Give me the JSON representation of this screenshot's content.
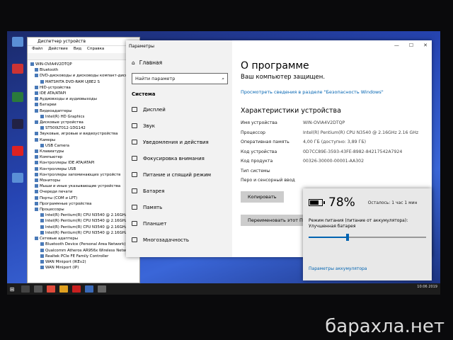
{
  "device_manager": {
    "title": "Диспетчер устройств",
    "menu": [
      "Файл",
      "Действие",
      "Вид",
      "Справка"
    ],
    "tree": [
      {
        "label": "WIN-OVIA4V2DTQP",
        "level": 0
      },
      {
        "label": "Bluetooth",
        "level": 1
      },
      {
        "label": "DVD-дисководы и дисководы компакт-дисков",
        "level": 1
      },
      {
        "label": "MATSHITA DVD-RAM UJ8E2 S",
        "level": 2
      },
      {
        "label": "HID-устройства",
        "level": 1
      },
      {
        "label": "IDE ATA/ATAPI",
        "level": 1
      },
      {
        "label": "Аудиовходы и аудиовыходы",
        "level": 1
      },
      {
        "label": "Батареи",
        "level": 1
      },
      {
        "label": "Видеоадаптеры",
        "level": 1
      },
      {
        "label": "Intel(R) HD Graphics",
        "level": 2
      },
      {
        "label": "Дисковые устройства",
        "level": 1
      },
      {
        "label": "ST500LT012-1DG142",
        "level": 2
      },
      {
        "label": "Звуковые, игровые и видеоустройства",
        "level": 1
      },
      {
        "label": "Камеры",
        "level": 1
      },
      {
        "label": "USB Camera",
        "level": 2
      },
      {
        "label": "Клавиатуры",
        "level": 1
      },
      {
        "label": "Компьютер",
        "level": 1
      },
      {
        "label": "Контроллеры IDE ATA/ATAPI",
        "level": 1
      },
      {
        "label": "Контроллеры USB",
        "level": 1
      },
      {
        "label": "Контроллеры запоминающих устройств",
        "level": 1
      },
      {
        "label": "Мониторы",
        "level": 1
      },
      {
        "label": "Мыши и иные указывающие устройства",
        "level": 1
      },
      {
        "label": "Очереди печати",
        "level": 1
      },
      {
        "label": "Порты (COM и LPT)",
        "level": 1
      },
      {
        "label": "Программные устройства",
        "level": 1
      },
      {
        "label": "Процессоры",
        "level": 1
      },
      {
        "label": "Intel(R) Pentium(R) CPU N3540 @ 2.16GHz",
        "level": 2
      },
      {
        "label": "Intel(R) Pentium(R) CPU N3540 @ 2.16GHz",
        "level": 2
      },
      {
        "label": "Intel(R) Pentium(R) CPU N3540 @ 2.16GHz",
        "level": 2
      },
      {
        "label": "Intel(R) Pentium(R) CPU N3540 @ 2.16GHz",
        "level": 2
      },
      {
        "label": "Сетевые адаптеры",
        "level": 1
      },
      {
        "label": "Bluetooth Device (Personal Area Network)",
        "level": 2
      },
      {
        "label": "Qualcomm Atheros AR956x Wireless Network Adapter",
        "level": 2
      },
      {
        "label": "Realtek PCIe FE Family Controller",
        "level": 2
      },
      {
        "label": "WAN Miniport (IKEv2)",
        "level": 2
      },
      {
        "label": "WAN Miniport (IP)",
        "level": 2
      }
    ]
  },
  "settings": {
    "window_title": "Параметры",
    "home_label": "Главная",
    "search_placeholder": "Найти параметр",
    "section_title": "Система",
    "nav": [
      {
        "label": "Дисплей",
        "icon": "display-icon"
      },
      {
        "label": "Звук",
        "icon": "sound-icon"
      },
      {
        "label": "Уведомления и действия",
        "icon": "notifications-icon"
      },
      {
        "label": "Фокусировка внимания",
        "icon": "focus-icon"
      },
      {
        "label": "Питание и спящий режим",
        "icon": "power-icon"
      },
      {
        "label": "Батарея",
        "icon": "battery-icon"
      },
      {
        "label": "Память",
        "icon": "storage-icon"
      },
      {
        "label": "Планшет",
        "icon": "tablet-icon"
      },
      {
        "label": "Многозадачность",
        "icon": "multitasking-icon"
      }
    ],
    "main": {
      "title": "О программе",
      "protected": "Ваш компьютер защищен.",
      "security_link": "Просмотреть сведения в разделе \"Безопасность Windows\"",
      "specs_title": "Характеристики устройства",
      "specs": [
        {
          "k": "Имя устройства",
          "v": "WIN-OVIA4V2DTQP"
        },
        {
          "k": "Процессор",
          "v": "Intel(R) Pentium(R) CPU N3540 @ 2.16GHz 2.16 GHz"
        },
        {
          "k": "Оперативная память",
          "v": "4,00 ГБ (доступно: 3,89 ГБ)"
        },
        {
          "k": "Код устройства",
          "v": "0D7CC89E-3593-43FE-8982-84217542A7924"
        },
        {
          "k": "Код продукта",
          "v": "00326-30000-00001-AA302"
        },
        {
          "k": "Тип системы",
          "v": ""
        },
        {
          "k": "Перо и сенсорный ввод",
          "v": ""
        }
      ],
      "copy_button": "Копировать",
      "rename_button": "Переименовать этот ПК"
    }
  },
  "battery": {
    "percent_label": "78%",
    "percent_value": 78,
    "remaining": "Осталось: 1 час 1 мин",
    "mode_label": "Режим питания (питание от аккумулятора):",
    "mode_value": "Улучшенная батарея",
    "slider_position": 0.33,
    "link": "Параметры аккумулятора"
  },
  "taskbar": {
    "clock": "10:06 2019"
  },
  "watermark": "барахла.нет",
  "colors": {
    "accent": "#0063b1",
    "desktop": "#2645b3",
    "taskbar": "#1c1c1c"
  }
}
